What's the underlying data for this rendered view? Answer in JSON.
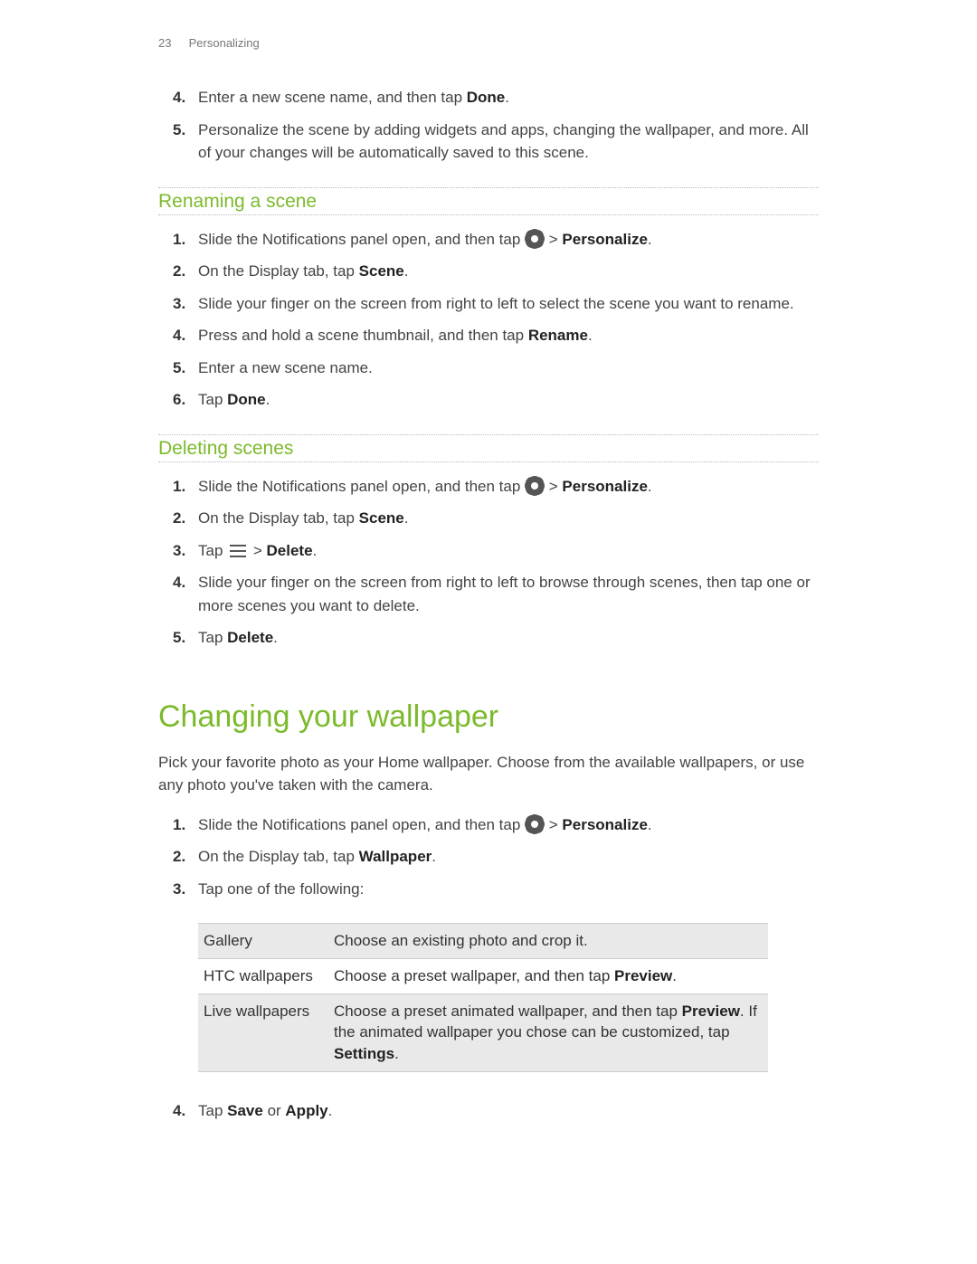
{
  "header": {
    "page_num": "23",
    "section": "Personalizing"
  },
  "scene_cont": [
    {
      "n": "4.",
      "pre": "Enter a new scene name, and then tap ",
      "bold": "Done",
      "post": "."
    },
    {
      "n": "5.",
      "pre": "Personalize the scene by adding widgets and apps, changing the wallpaper, and more. All of your changes will be automatically saved to this scene.",
      "bold": "",
      "post": ""
    }
  ],
  "rename": {
    "title": "Renaming a scene",
    "steps": {
      "s1_pre": "Slide the Notifications panel open, and then tap ",
      "s1_mid": " > ",
      "s1_bold": "Personalize",
      "s1_post": ".",
      "s2_pre": "On the Display tab, tap ",
      "s2_bold": "Scene",
      "s2_post": ".",
      "s3": "Slide your finger on the screen from right to left to select the scene you want to rename.",
      "s4_pre": "Press and hold a scene thumbnail, and then tap ",
      "s4_bold": "Rename",
      "s4_post": ".",
      "s5": "Enter a new scene name.",
      "s6_pre": "Tap ",
      "s6_bold": "Done",
      "s6_post": "."
    }
  },
  "delete": {
    "title": "Deleting scenes",
    "steps": {
      "s1_pre": "Slide the Notifications panel open, and then tap ",
      "s1_mid": " > ",
      "s1_bold": "Personalize",
      "s1_post": ".",
      "s2_pre": "On the Display tab, tap ",
      "s2_bold": "Scene",
      "s2_post": ".",
      "s3_pre": "Tap ",
      "s3_mid": " > ",
      "s3_bold": "Delete",
      "s3_post": ".",
      "s4": "Slide your finger on the screen from right to left to browse through scenes, then tap one or more scenes you want to delete.",
      "s5_pre": "Tap ",
      "s5_bold": "Delete",
      "s5_post": "."
    }
  },
  "wallpaper": {
    "title": "Changing your wallpaper",
    "intro": "Pick your favorite photo as your Home wallpaper. Choose from the available wallpapers, or use any photo you've taken with the camera.",
    "steps": {
      "s1_pre": "Slide the Notifications panel open, and then tap ",
      "s1_mid": " > ",
      "s1_bold": "Personalize",
      "s1_post": ".",
      "s2_pre": "On the Display tab, tap ",
      "s2_bold": "Wallpaper",
      "s2_post": ".",
      "s3": "Tap one of the following:",
      "s4_pre": "Tap ",
      "s4_b1": "Save",
      "s4_mid": " or ",
      "s4_b2": "Apply",
      "s4_post": "."
    },
    "table": {
      "r1k": "Gallery",
      "r1v": "Choose an existing photo and crop it.",
      "r2k": "HTC wallpapers",
      "r2v_pre": "Choose a preset wallpaper, and then tap ",
      "r2v_bold": "Preview",
      "r2v_post": ".",
      "r3k": "Live wallpapers",
      "r3v_pre": "Choose a preset animated wallpaper, and then tap ",
      "r3v_b1": "Preview",
      "r3v_mid": ". If the animated wallpaper you chose can be customized, tap ",
      "r3v_b2": "Settings",
      "r3v_post": "."
    }
  }
}
